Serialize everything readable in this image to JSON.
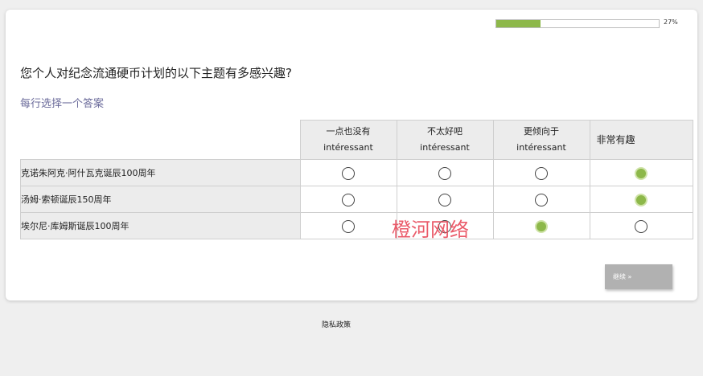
{
  "progress": {
    "value": 0.27,
    "text": "27%"
  },
  "question": "您个人对纪念流通硬币计划的以下主题有多感兴趣?",
  "instruction": "每行选择一个答案",
  "columns": [
    {
      "line1": "一点也没有",
      "line2": "intéressant"
    },
    {
      "line1": "不太好吧",
      "line2": "intéressant"
    },
    {
      "line1": "更倾向于",
      "line2": "intéressant"
    },
    {
      "line1": "非常有趣",
      "line2": ""
    }
  ],
  "rows": [
    {
      "label": "克诺朱阿克·阿什瓦克诞辰100周年",
      "selected": 3
    },
    {
      "label": "汤姆·索顿诞辰150周年",
      "selected": 3
    },
    {
      "label": "埃尔尼·库姆斯诞辰100周年",
      "selected": 2
    }
  ],
  "watermark": "橙河网络",
  "continue_label": "继续 »",
  "footer": {
    "privacy_label": "隐私政策"
  },
  "colors": {
    "accent": "#8db84a",
    "instruction": "#6a6a9a",
    "button": "#b1b1b1"
  }
}
